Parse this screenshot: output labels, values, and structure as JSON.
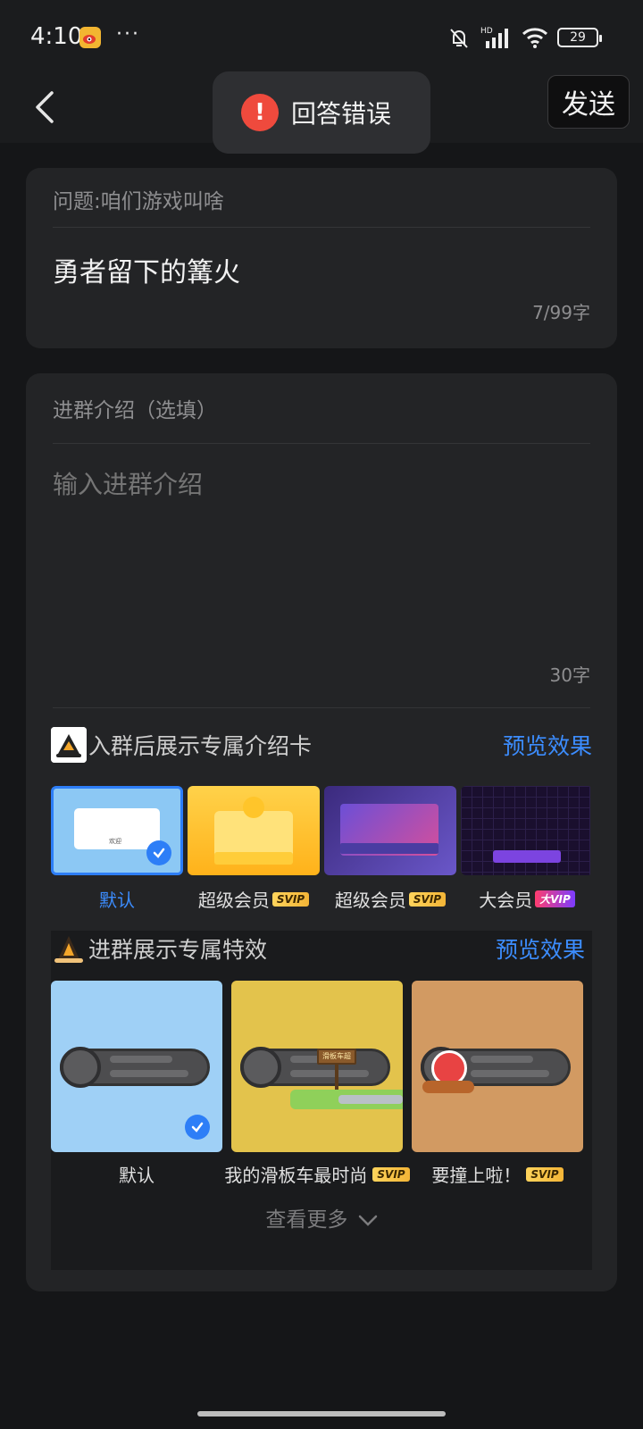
{
  "status_bar": {
    "time": "4:10",
    "dots": "···",
    "battery": "29",
    "network": "HD"
  },
  "nav": {
    "send_label": "发送"
  },
  "toast": {
    "text": "回答错误"
  },
  "question": {
    "label": "问题:咱们游戏叫啥",
    "answer": "勇者留下的篝火",
    "count": "7/99字"
  },
  "intro": {
    "label": "进群介绍（选填）",
    "placeholder": "输入进群介绍",
    "count": "30字"
  },
  "intro_card": {
    "title": "入群后展示专属介绍卡",
    "preview": "预览效果",
    "items": [
      {
        "label": "默认",
        "badge": ""
      },
      {
        "label": "超级会员",
        "badge": "SVIP"
      },
      {
        "label": "超级会员",
        "badge": "SVIP"
      },
      {
        "label": "大会员",
        "badge": "大VIP"
      }
    ],
    "welcome": "欢迎"
  },
  "effects": {
    "title": "进群展示专属特效",
    "preview": "预览效果",
    "items": [
      {
        "label": "默认",
        "badge": ""
      },
      {
        "label": "我的滑板车最时尚",
        "badge": "SVIP"
      },
      {
        "label": "要撞上啦！",
        "badge": "SVIP"
      }
    ],
    "sign_text": "滑板车超",
    "see_more": "查看更多"
  },
  "colors": {
    "accent": "#3c8dff",
    "error": "#ef4a3d",
    "background": "#151618",
    "card": "#232426"
  }
}
